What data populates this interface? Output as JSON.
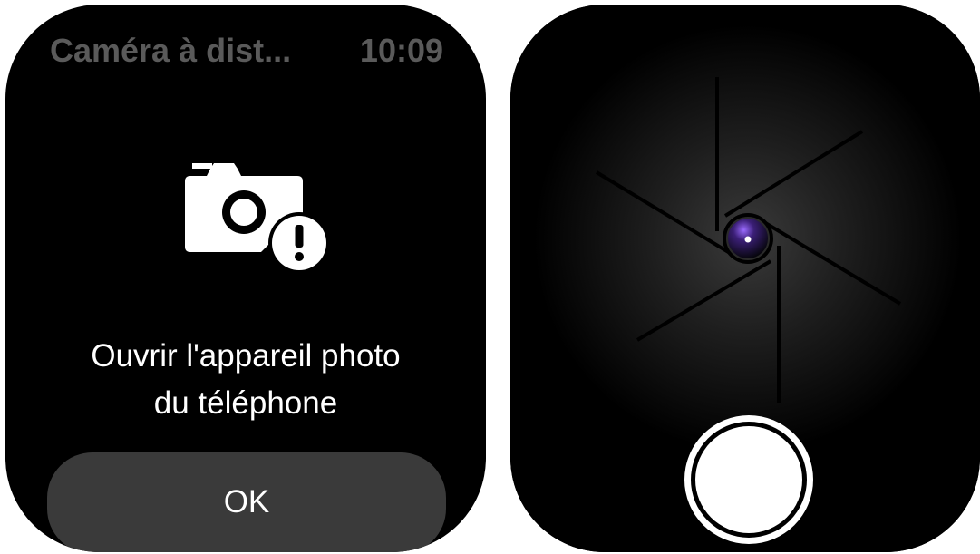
{
  "left_screen": {
    "status_bar": {
      "title": "Caméra à dist...",
      "time": "10:09"
    },
    "icon": "camera-warning-icon",
    "message_line_1": "Ouvrir l'appareil photo",
    "message_line_2": "du téléphone",
    "ok_button_label": "OK"
  },
  "right_screen": {
    "aperture_icon": "camera-aperture-icon",
    "shutter_button_icon": "shutter-button-icon"
  },
  "colors": {
    "screen_background": "#000000",
    "status_text": "#5a5a5a",
    "button_background": "#3a3a3a",
    "text": "#ffffff",
    "lens_accent": "#7b3fe4"
  }
}
